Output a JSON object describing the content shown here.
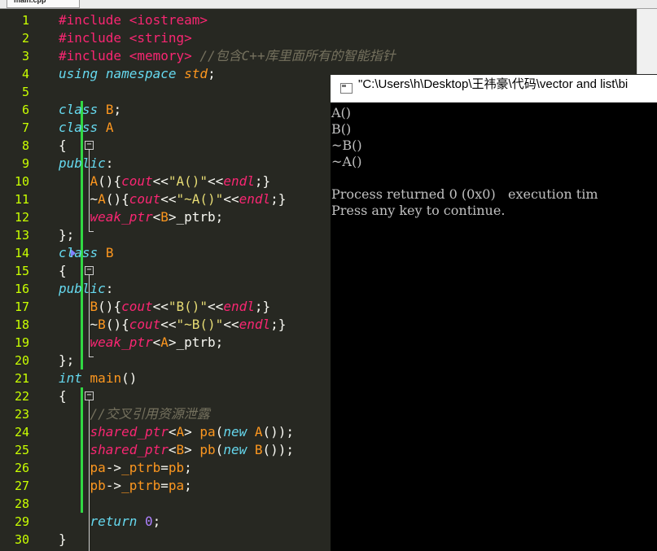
{
  "tab": {
    "label": "main.cpp"
  },
  "editor": {
    "lines": [
      {
        "n": "1",
        "html": "<span class='pp'>#include &lt;iostream&gt;</span>"
      },
      {
        "n": "2",
        "html": "<span class='pp'>#include &lt;string&gt;</span>"
      },
      {
        "n": "3",
        "html": "<span class='pp'>#include &lt;memory&gt;</span> <span class='cm'>//包含C++库里面所有的智能指针</span>"
      },
      {
        "n": "4",
        "html": "<span class='kw'>using</span> <span class='kw'>namespace</span> <span class='ns'>std</span>;"
      },
      {
        "n": "5",
        "html": ""
      },
      {
        "n": "6",
        "html": "<span class='kw'>class</span> <span class='ty'>B</span>;"
      },
      {
        "n": "7",
        "html": "<span class='kw'>class</span> <span class='ty'>A</span>"
      },
      {
        "n": "8",
        "html": "{"
      },
      {
        "n": "9",
        "html": "<span class='kw'>public</span>:"
      },
      {
        "n": "10",
        "html": "    <span class='fn'>A</span>(){<span class='std'>cout</span>&lt;&lt;<span class='st'>\"A()\"</span>&lt;&lt;<span class='std'>endl</span>;}"
      },
      {
        "n": "11",
        "html": "    ~<span class='fn'>A</span>(){<span class='std'>cout</span>&lt;&lt;<span class='st'>\"~A()\"</span>&lt;&lt;<span class='std'>endl</span>;}"
      },
      {
        "n": "12",
        "html": "    <span class='std'>weak_ptr</span>&lt;<span class='ty'>B</span>&gt;_ptrb;"
      },
      {
        "n": "13",
        "html": "};"
      },
      {
        "n": "14",
        "html": "<span class='kw'>class</span> <span class='ty'>B</span>"
      },
      {
        "n": "15",
        "html": "{"
      },
      {
        "n": "16",
        "html": "<span class='kw'>public</span>:"
      },
      {
        "n": "17",
        "html": "    <span class='fn'>B</span>(){<span class='std'>cout</span>&lt;&lt;<span class='st'>\"B()\"</span>&lt;&lt;<span class='std'>endl</span>;}"
      },
      {
        "n": "18",
        "html": "    ~<span class='fn'>B</span>(){<span class='std'>cout</span>&lt;&lt;<span class='st'>\"~B()\"</span>&lt;&lt;<span class='std'>endl</span>;}"
      },
      {
        "n": "19",
        "html": "    <span class='std'>weak_ptr</span>&lt;<span class='ty'>A</span>&gt;_ptrb;"
      },
      {
        "n": "20",
        "html": "};"
      },
      {
        "n": "21",
        "html": "<span class='kw'>int</span> <span class='fn'>main</span>()"
      },
      {
        "n": "22",
        "html": "{"
      },
      {
        "n": "23",
        "html": "    <span class='cm'>//交叉引用资源泄露</span>"
      },
      {
        "n": "24",
        "html": "    <span class='std'>shared_ptr</span>&lt;<span class='ty'>A</span>&gt; <span class='fn'>pa</span>(<span class='kw'>new</span> <span class='fn'>A</span>());"
      },
      {
        "n": "25",
        "html": "    <span class='std'>shared_ptr</span>&lt;<span class='ty'>B</span>&gt; <span class='fn'>pb</span>(<span class='kw'>new</span> <span class='fn'>B</span>());"
      },
      {
        "n": "26",
        "html": "    <span class='fn'>pa</span>-&gt;<span class='fn'>_ptrb</span>=<span class='fn'>pb</span>;"
      },
      {
        "n": "27",
        "html": "    <span class='fn'>pb</span>-&gt;<span class='fn'>_ptrb</span>=<span class='fn'>pa</span>;"
      },
      {
        "n": "28",
        "html": ""
      },
      {
        "n": "29",
        "html": "    <span class='kw'>return</span> <span class='num'>0</span>;"
      },
      {
        "n": "30",
        "html": "}"
      }
    ]
  },
  "console": {
    "title": "\"C:\\Users\\h\\Desktop\\王祎豪\\代码\\vector and list\\bi",
    "output": "A()\nB()\n~B()\n~A()\n\nProcess returned 0 (0x0)   execution tim\nPress any key to continue."
  },
  "colors": {
    "editor_bg": "#272822",
    "line_numbers": "#c9ff00",
    "change_bar": "#31d843",
    "console_bg": "#000000"
  }
}
